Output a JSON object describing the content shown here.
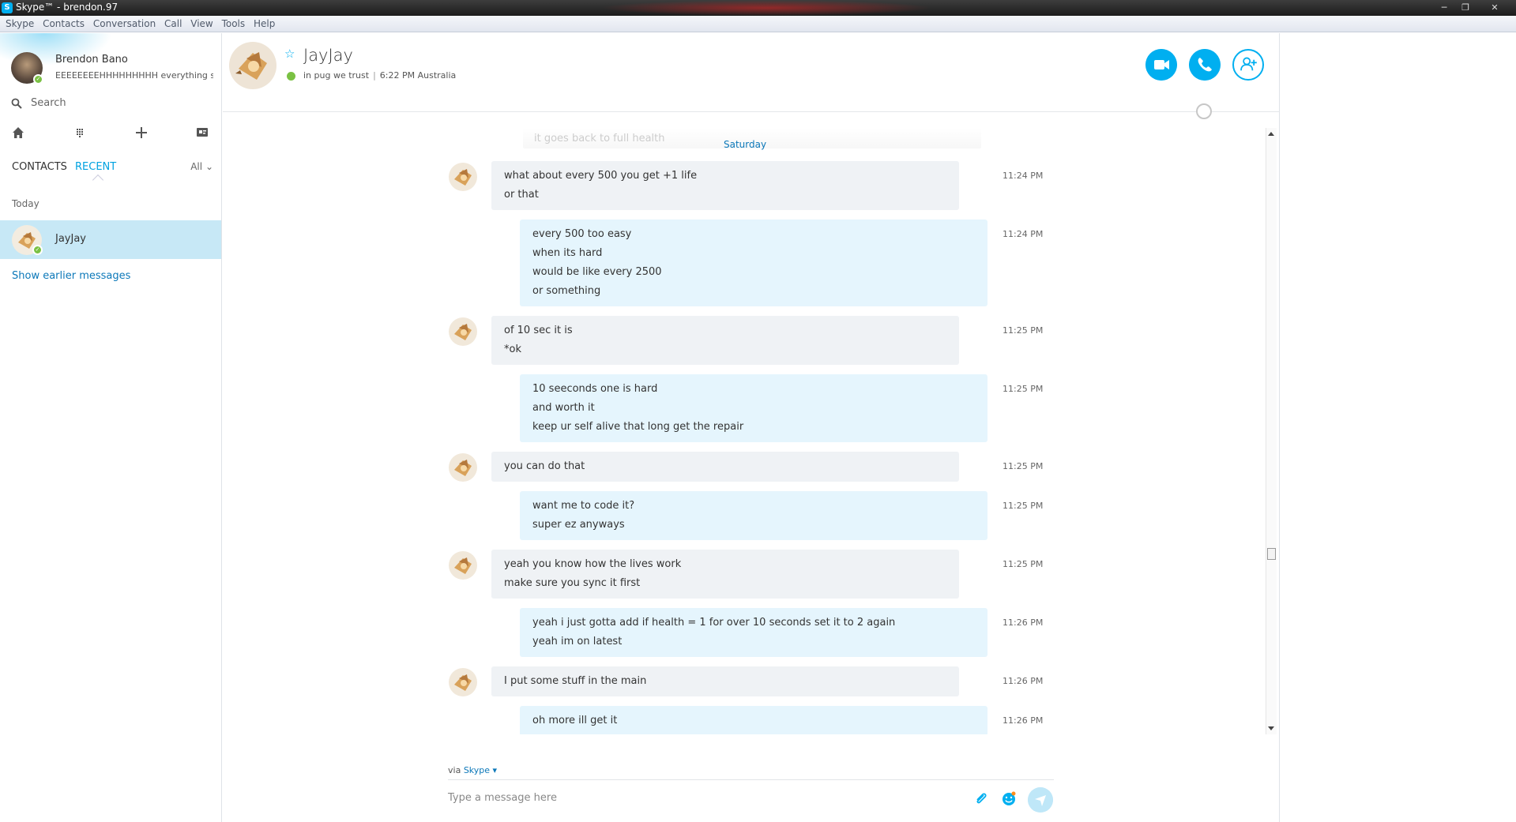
{
  "window": {
    "title": "Skype™ - brendon.97"
  },
  "menu": [
    "Skype",
    "Contacts",
    "Conversation",
    "Call",
    "View",
    "Tools",
    "Help"
  ],
  "profile": {
    "name": "Brendon Bano",
    "mood": "EEEEEEEEHHHHHHHHH everything s..."
  },
  "search": {
    "placeholder": "Search"
  },
  "tabs": {
    "contacts": "CONTACTS",
    "recent": "RECENT",
    "filter": "All"
  },
  "recent": {
    "group": "Today",
    "items": [
      {
        "name": "JayJay"
      }
    ],
    "show_earlier": "Show earlier messages"
  },
  "contact": {
    "name": "JayJay",
    "mood": "in pug we trust",
    "local_time": "6:22 PM Australia"
  },
  "chat": {
    "faded_text": "it goes back to full health",
    "day_separator": "Saturday",
    "messages": [
      {
        "dir": "in",
        "time": "11:24 PM",
        "lines": [
          "what about every 500 you get +1 life",
          "or that"
        ]
      },
      {
        "dir": "out",
        "time": "11:24 PM",
        "lines": [
          "every 500 too easy",
          "when its hard",
          "would be like every 2500",
          "or something"
        ]
      },
      {
        "dir": "in",
        "time": "11:25 PM",
        "lines": [
          "of 10 sec it is",
          "*ok"
        ]
      },
      {
        "dir": "out",
        "time": "11:25 PM",
        "lines": [
          "10 seeconds one is hard",
          "and worth it",
          "keep ur self alive that long get the repair"
        ]
      },
      {
        "dir": "in",
        "time": "11:25 PM",
        "lines": [
          "you can do that"
        ]
      },
      {
        "dir": "out",
        "time": "11:25 PM",
        "lines": [
          "want me to code it?",
          "super ez anyways"
        ]
      },
      {
        "dir": "in",
        "time": "11:25 PM",
        "lines": [
          "yeah you know how the lives work",
          "make sure you sync it first"
        ]
      },
      {
        "dir": "out",
        "time": "11:26 PM",
        "lines": [
          "yeah i just gotta add if health = 1 for over 10 seconds set it to 2 again",
          "yeah im on latest"
        ]
      },
      {
        "dir": "in",
        "time": "11:26 PM",
        "lines": [
          "I put some stuff in the main"
        ]
      },
      {
        "dir": "out",
        "time": "11:26 PM",
        "lines": [
          "oh more ill get it"
        ]
      }
    ]
  },
  "compose": {
    "via_label": "via",
    "via_service": "Skype",
    "placeholder": "Type a message here"
  },
  "colors": {
    "accent": "#00aff0",
    "link": "#0c78b9",
    "online": "#7ac143",
    "selected_row": "#c7e8f6"
  }
}
